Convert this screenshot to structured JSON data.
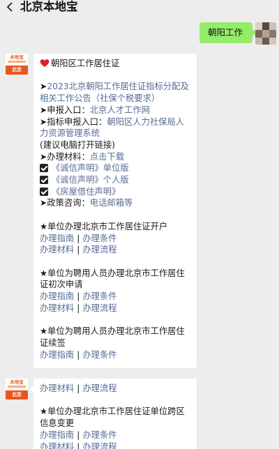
{
  "header": {
    "title": "北京本地宝"
  },
  "user_message": "朝阳工作",
  "bot": {
    "logo_text": "本地宝",
    "city_label": "北京"
  },
  "message1": {
    "title": "朝阳区工作居住证",
    "notice_prefix": "➤",
    "notice_link": "2023北京朝阳工作居住证指标分配及相关工作公告（社保个税要求）",
    "apply_prefix": "➤申报入口：",
    "apply_link": "北京人才工作网",
    "quota_prefix": "➤指标申报入口：",
    "quota_link": "朝阳区人力社保局人力资源管理系统",
    "pc_note": "(建议电脑打开链接)",
    "materials_prefix": "➤办理材料：",
    "materials_link": "点击下载",
    "docs": [
      "《诚信声明》单位版",
      "《诚信声明》个人版",
      "《房屋借住声明》"
    ],
    "consult_prefix": "➤政策咨询：",
    "consult_link": "电话邮箱等",
    "sections": [
      {
        "title": "★单位办理北京市工作居住证开户",
        "links": [
          [
            "办理指南",
            "办理条件"
          ],
          [
            "办理材料",
            "办理流程"
          ]
        ]
      },
      {
        "title": "★单位为聘用人员办理北京市工作居住证初次申请",
        "links": [
          [
            "办理指南",
            "办理条件"
          ],
          [
            "办理材料",
            "办理流程"
          ]
        ]
      },
      {
        "title": "★单位为聘用人员办理北京市工作居住证续签",
        "links": [
          [
            "办理指南",
            "办理条件"
          ]
        ]
      }
    ],
    "link_separator": "|"
  },
  "message2": {
    "top_links": [
      "办理材料",
      "办理流程"
    ],
    "section_title": "★单位办理北京市工作居住证单位跨区信息变更",
    "links": [
      [
        "办理指南",
        "办理条件"
      ],
      [
        "办理材料",
        "办理流程"
      ]
    ]
  },
  "colors": {
    "link": "#576b95",
    "user_bubble": "#95ec69",
    "background": "#ededed",
    "brand": "#e8561e"
  }
}
